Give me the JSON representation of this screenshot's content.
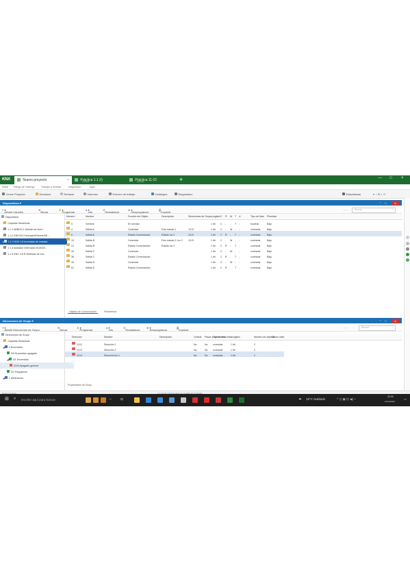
{
  "titlebar": {
    "logo": "KNX",
    "tabs": [
      {
        "label": "Nuevo proyecto",
        "sub": ""
      },
      {
        "label": "Práctica 1.1 (I)",
        "sub": "Inversión"
      },
      {
        "label": "Práctica 11 02",
        "sub": "Inversión"
      }
    ],
    "plus": "+",
    "min": "—",
    "max": "□",
    "close": "×"
  },
  "menubar": {
    "items": [
      "Editar",
      "Trabajo de Catálogo",
      "Trabajar a Verificar",
      "Diagnóstico",
      "Apps"
    ]
  },
  "toolbar": {
    "items": [
      "Cerrar Proyecto",
      "Deshacer",
      "Rehacer",
      "Informes",
      "Entorno de trabajo",
      "Catálogos",
      "Diagnóstico"
    ],
    "right": "Estadísticas"
  },
  "dispositivos": {
    "title": "Dispositivos",
    "toolbar": [
      "Añadir Canales",
      "Borrar",
      "Programar",
      "Info",
      "Restablecer",
      "Desprogramar",
      "Imprimir"
    ],
    "search_placeholder": "Buscar",
    "tree": [
      "Dispositivos",
      "Carpetas Dinámicas",
      "1.1.1 ABB/S3.1 Módulo de Ilumi...",
      "1.1.2 KNX/S4.2 Actuador/Dimme/AE...",
      "1.1.3 KNX 4.8 Inventado de entrada",
      "1.1.4 Actuador Interruptor 6/16/32/...",
      "1.1.5 KNX 4.8 B Ventilado de ent..."
    ],
    "columns": [
      "Número",
      "Nombre",
      "Función del Objeto",
      "Descripción",
      "Direcciones de Grupo",
      "Longitud",
      "C",
      "R",
      "W",
      "T",
      "U",
      "Tipo de Dato",
      "Prioridad"
    ],
    "rows": [
      {
        "num": "0",
        "name": "General",
        "func": "En servicio",
        "desc": "",
        "group": "",
        "len": "1 bit",
        "c": "C",
        "r": "-",
        "w": "-",
        "t": "T",
        "u": "-",
        "type": "boolean",
        "prio": "Bajo"
      },
      {
        "num": "4",
        "name": "Salida A",
        "func": "Conmutar",
        "desc": "Puls mando 1",
        "group": "1/1/2",
        "len": "1 bit",
        "c": "C",
        "r": "-",
        "w": "W",
        "t": "-",
        "u": "-",
        "type": "conmutar",
        "prio": "Bajo"
      },
      {
        "num": "6",
        "name": "Salida A",
        "func": "Estado Conmutación",
        "desc": "Estado luz 1",
        "group": "1/1/4",
        "len": "1 bit",
        "c": "C",
        "r": "R",
        "w": "-",
        "t": "T",
        "u": "-",
        "type": "conmutar",
        "prio": "Bajo"
      },
      {
        "num": "19",
        "name": "Salida B",
        "func": "Conmutar",
        "desc": "Puls mando 2, luz 2",
        "group": "1/1/3",
        "len": "1 bit",
        "c": "C",
        "r": "-",
        "w": "W",
        "t": "-",
        "u": "-",
        "type": "conmutar",
        "prio": "Bajo"
      },
      {
        "num": "21",
        "name": "Salida B",
        "func": "Estado Conmutación",
        "desc": "Estado luz 2",
        "group": "",
        "len": "1 bit",
        "c": "C",
        "r": "R",
        "w": "-",
        "t": "T",
        "u": "-",
        "type": "conmutar",
        "prio": "Bajo"
      },
      {
        "num": "34",
        "name": "Salida C",
        "func": "Conmutar",
        "desc": "",
        "group": "",
        "len": "1 bit",
        "c": "C",
        "r": "-",
        "w": "W",
        "t": "-",
        "u": "-",
        "type": "conmutar",
        "prio": "Bajo"
      },
      {
        "num": "36",
        "name": "Salida C",
        "func": "Estado Conmutación",
        "desc": "",
        "group": "",
        "len": "1 bit",
        "c": "C",
        "r": "R",
        "w": "-",
        "t": "T",
        "u": "-",
        "type": "conmutar",
        "prio": "Bajo"
      },
      {
        "num": "49",
        "name": "Salida D",
        "func": "Conmutar",
        "desc": "",
        "group": "",
        "len": "1 bit",
        "c": "C",
        "r": "-",
        "w": "W",
        "t": "-",
        "u": "-",
        "type": "conmutar",
        "prio": "Bajo"
      },
      {
        "num": "51",
        "name": "Salida D",
        "func": "Estado Conmutación",
        "desc": "",
        "group": "",
        "len": "1 bit",
        "c": "C",
        "r": "R",
        "w": "-",
        "t": "T",
        "u": "-",
        "type": "conmutar",
        "prio": "Bajo"
      }
    ],
    "bottom_tabs": [
      "Objetos de Comunicación",
      "Parámetros"
    ]
  },
  "direcciones": {
    "title": "Direcciones de Grupo",
    "toolbar": [
      "Añadir Direcciones de Grupo",
      "Borrar",
      "Programar",
      "Info",
      "Restablecer",
      "Desprogramar",
      "Imprimir"
    ],
    "search_placeholder": "Buscar",
    "tree": [
      "Direcciones de Grupo",
      "Carpetas Dinámicas",
      "0 Encendido",
      "0/0 Encendido apagado",
      "0/1 Encendido",
      "0/1/0 Apagado general",
      "0/1 Regulación",
      "1 Iluminación"
    ],
    "columns": [
      "Dirección",
      "Nombre",
      "Descripción",
      "Central",
      "Pasar a través de la línea",
      "Tipo de dato",
      "Longitud",
      "Número de objetos",
      "Último valor"
    ],
    "rows": [
      {
        "addr": "1/1/2",
        "name": "Dirección 1",
        "desc": "",
        "central": "No",
        "pass": "No",
        "type": "conmutar",
        "len": "1 bit",
        "count": "2",
        "last": ""
      },
      {
        "addr": "1/1/3",
        "name": "Dirección 2",
        "desc": "",
        "central": "No",
        "pass": "No",
        "type": "conmutar",
        "len": "1 bit",
        "count": "2",
        "last": ""
      },
      {
        "addr": "1/1/4",
        "name": "Dirección luz 1",
        "desc": "",
        "central": "No",
        "pass": "No",
        "type": "conmutar",
        "len": "1 bit",
        "count": "1",
        "last": ""
      }
    ],
    "bottom_tab": "Propiedades de Grupo"
  },
  "status": {
    "left": "Nuevo proyecto",
    "center": "1.1.3 KNX 4.8 Inventado de entrada de 8 canales"
  },
  "taskbar": {
    "search_placeholder": "Escribe aquí para buscar",
    "weather": "18°C Nublado",
    "time": "20:30",
    "date": "14/11/2022"
  },
  "colors": {
    "titlebar": "#1e6b2f",
    "panel_header": "#1d6fb5",
    "selection": "#1b5fa8",
    "taskbar": "#1f1f1f"
  }
}
